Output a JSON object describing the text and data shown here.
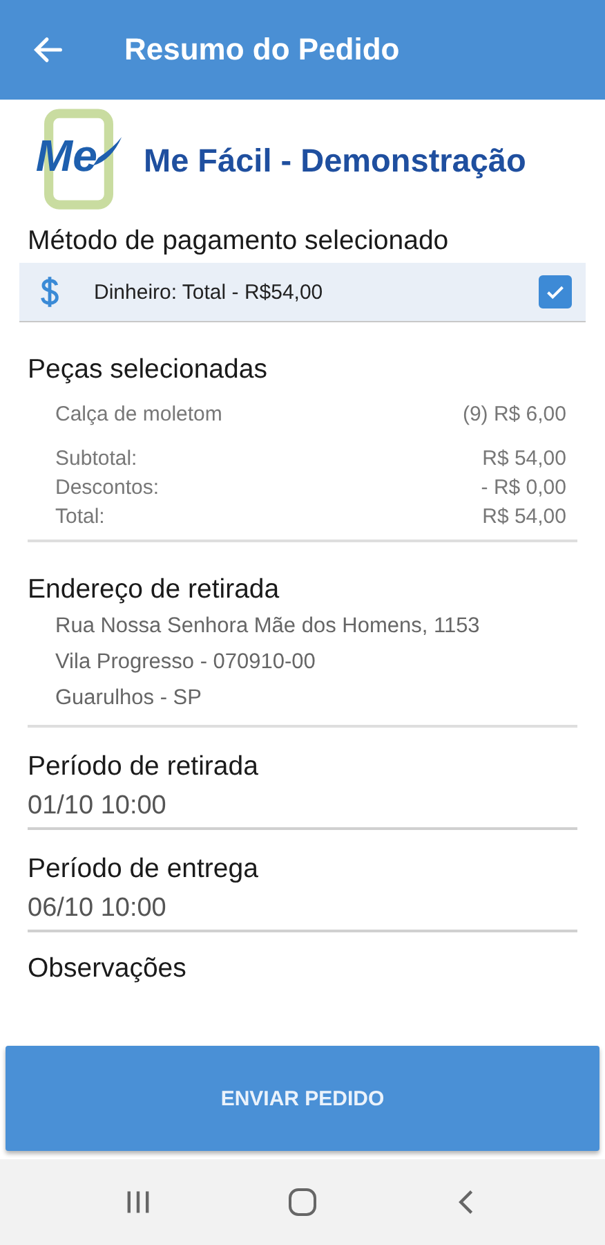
{
  "app_bar": {
    "title": "Resumo do Pedido"
  },
  "brand": {
    "logo_text": "Me",
    "name": "Me Fácil - Demonstração"
  },
  "payment": {
    "heading": "Método de pagamento selecionado",
    "method": "Dinheiro: Total - R$54,00",
    "checked": true
  },
  "items": {
    "heading": "Peças selecionadas",
    "lines": [
      {
        "name": "Calça de moletom",
        "price": "(9) R$ 6,00"
      }
    ],
    "totals": [
      {
        "label": "Subtotal:",
        "value": "R$ 54,00"
      },
      {
        "label": "Descontos:",
        "value": "- R$ 0,00"
      },
      {
        "label": "Total:",
        "value": "R$ 54,00"
      }
    ]
  },
  "address": {
    "heading": "Endereço de retirada",
    "lines": [
      "Rua Nossa Senhora Mãe dos Homens, 1153",
      "Vila Progresso - 070910-00",
      "Guarulhos - SP"
    ]
  },
  "fields": [
    {
      "label": "Período de retirada",
      "value": "01/10 10:00"
    },
    {
      "label": "Período de entrega",
      "value": "06/10 10:00"
    }
  ],
  "notes": {
    "heading": "Observações"
  },
  "submit_button": "ENVIAR PEDIDO"
}
